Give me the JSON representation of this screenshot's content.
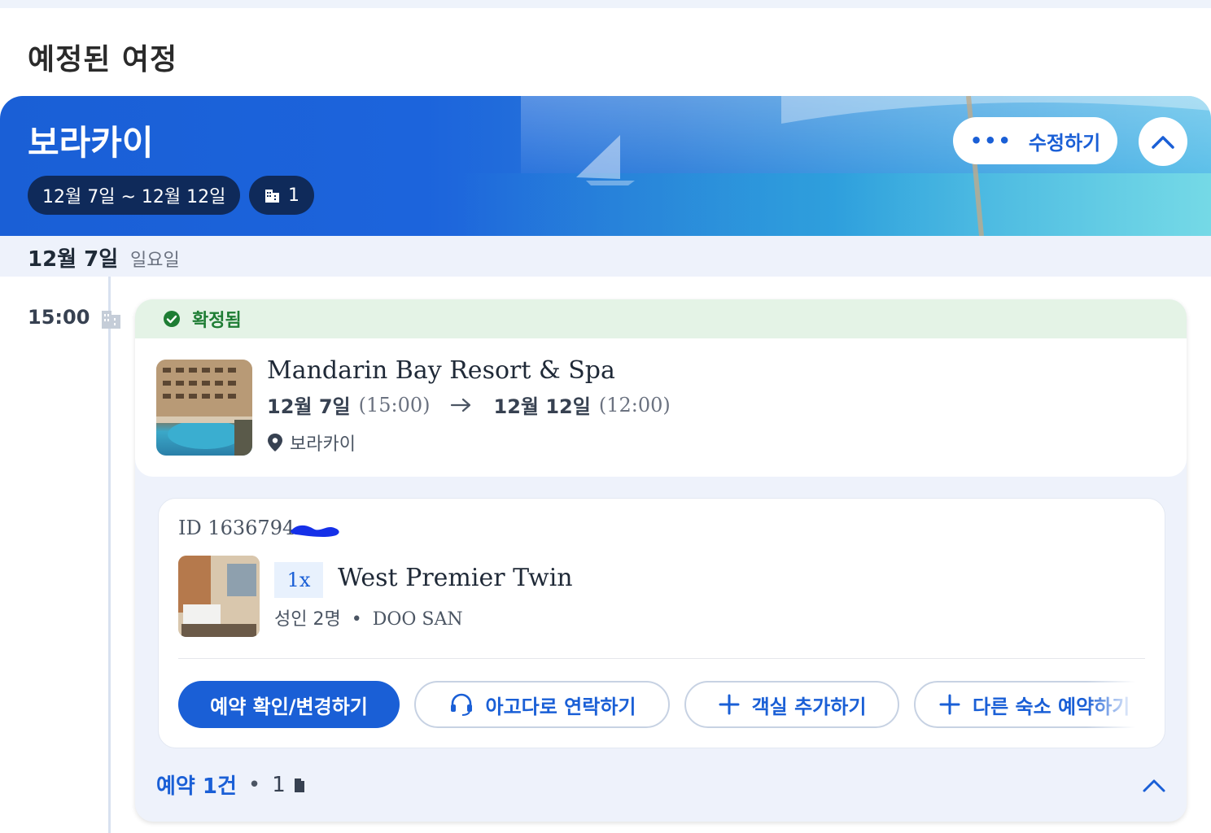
{
  "page": {
    "title": "예정된 여정"
  },
  "trip": {
    "destination": "보라카이",
    "dates": "12월 7일 ~ 12월 12일",
    "property_count": "1",
    "edit_label": "수정하기",
    "more_icon": "ellipsis-icon",
    "collapse_icon": "chevron-up-icon"
  },
  "day": {
    "date": "12월 7일",
    "weekday": "일요일"
  },
  "timeline": {
    "time": "15:00",
    "icon": "building-icon"
  },
  "booking": {
    "status": "확정됨",
    "hotel_name": "Mandarin Bay Resort & Spa",
    "checkin_date": "12월 7일",
    "checkin_time": "(15:00)",
    "checkout_date": "12월 12일",
    "checkout_time": "(12:00)",
    "location": "보라카이",
    "id_label": "ID 1636794",
    "room": {
      "quantity": "1x",
      "name": "West Premier Twin",
      "guests": "성인 2명",
      "separator": "•",
      "guest_name": "DOO SAN"
    },
    "actions": {
      "manage": "예약 확인/변경하기",
      "contact": "아고다로 연락하기",
      "add_room": "객실 추가하기",
      "book_other": "다른 숙소 예약하기"
    },
    "summary": {
      "count": "예약 1건",
      "separator": "•",
      "rooms": "1"
    }
  },
  "colors": {
    "primary": "#1a5fd6",
    "confirmed": "#1e7d34",
    "confirmed_bg": "#e4f3e6",
    "chip": "#0f2a5a"
  }
}
